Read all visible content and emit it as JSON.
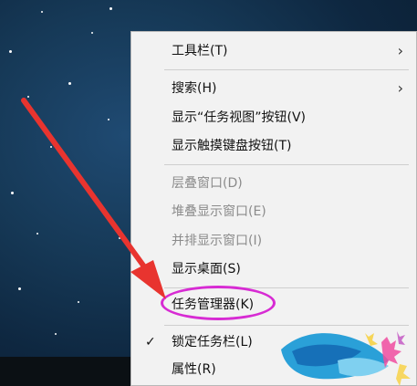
{
  "context_menu": {
    "items": [
      {
        "label": "工具栏(T)",
        "submenu": true
      },
      {
        "label": "搜索(H)",
        "submenu": true
      },
      {
        "label": "显示“任务视图”按钮(V)"
      },
      {
        "label": "显示触摸键盘按钮(T)"
      },
      {
        "label": "层叠窗口(D)",
        "disabled": true
      },
      {
        "label": "堆叠显示窗口(E)",
        "disabled": true
      },
      {
        "label": "并排显示窗口(I)",
        "disabled": true
      },
      {
        "label": "显示桌面(S)"
      },
      {
        "label": "任务管理器(K)",
        "highlighted": true
      },
      {
        "label": "锁定任务栏(L)",
        "checked": true
      },
      {
        "label": "属性(R)"
      }
    ],
    "submenu_glyph": "›",
    "check_glyph": "✓"
  },
  "annotations": {
    "arrow_color": "#e8342f",
    "highlight_color": "#d72bd3"
  }
}
